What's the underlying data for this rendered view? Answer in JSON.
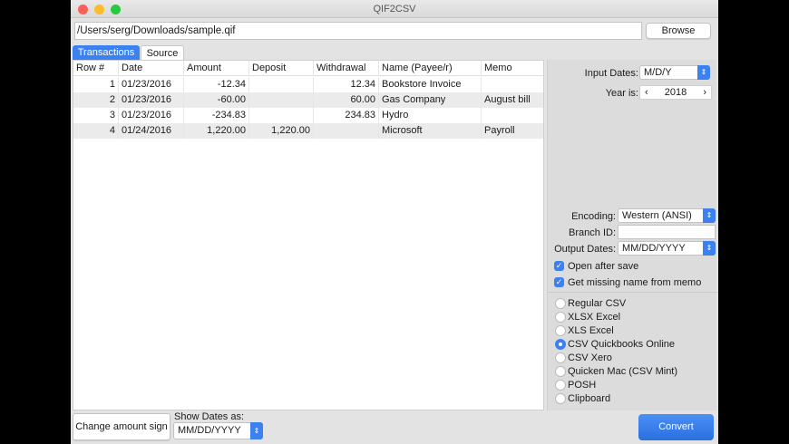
{
  "window": {
    "title": "QIF2CSV"
  },
  "file": {
    "path": "/Users/serg/Downloads/sample.qif",
    "browse_label": "Browse"
  },
  "tabs": [
    {
      "label": "Transactions",
      "active": true
    },
    {
      "label": "Source",
      "active": false
    }
  ],
  "table": {
    "columns": [
      "Row #",
      "Date",
      "Amount",
      "Deposit",
      "Withdrawal",
      "Name (Payee/r)",
      "Memo"
    ],
    "rows": [
      [
        "1",
        "01/23/2016",
        "-12.34",
        "",
        "12.34",
        "Bookstore Invoice",
        ""
      ],
      [
        "2",
        "01/23/2016",
        "-60.00",
        "",
        "60.00",
        "Gas Company",
        "August bill"
      ],
      [
        "3",
        "01/23/2016",
        "-234.83",
        "",
        "234.83",
        "Hydro",
        ""
      ],
      [
        "4",
        "01/24/2016",
        "1,220.00",
        "1,220.00",
        "",
        "Microsoft",
        "Payroll"
      ]
    ]
  },
  "settings": {
    "input_dates_label": "Input Dates:",
    "input_dates": "M/D/Y",
    "year_label": "Year is:",
    "year": "2018",
    "encoding_label": "Encoding:",
    "encoding": "Western (ANSI)",
    "branch_label": "Branch ID:",
    "branch_id": "",
    "output_dates_label": "Output Dates:",
    "output_dates": "MM/DD/YYYY",
    "open_after_save": "Open after save",
    "get_missing_name": "Get missing name from memo"
  },
  "formats": [
    {
      "label": "Regular CSV",
      "selected": false
    },
    {
      "label": "XLSX Excel",
      "selected": false
    },
    {
      "label": "XLS Excel",
      "selected": false
    },
    {
      "label": "CSV Quickbooks Online",
      "selected": true
    },
    {
      "label": "CSV Xero",
      "selected": false
    },
    {
      "label": "Quicken Mac (CSV Mint)",
      "selected": false
    },
    {
      "label": "POSH",
      "selected": false
    },
    {
      "label": "Clipboard",
      "selected": false
    }
  ],
  "bottom": {
    "change_sign_label": "Change amount sign",
    "show_dates_label": "Show Dates as:",
    "show_dates": "MM/DD/YYYY",
    "convert_label": "Convert"
  },
  "colors": {
    "accent": "#3b82f0"
  }
}
